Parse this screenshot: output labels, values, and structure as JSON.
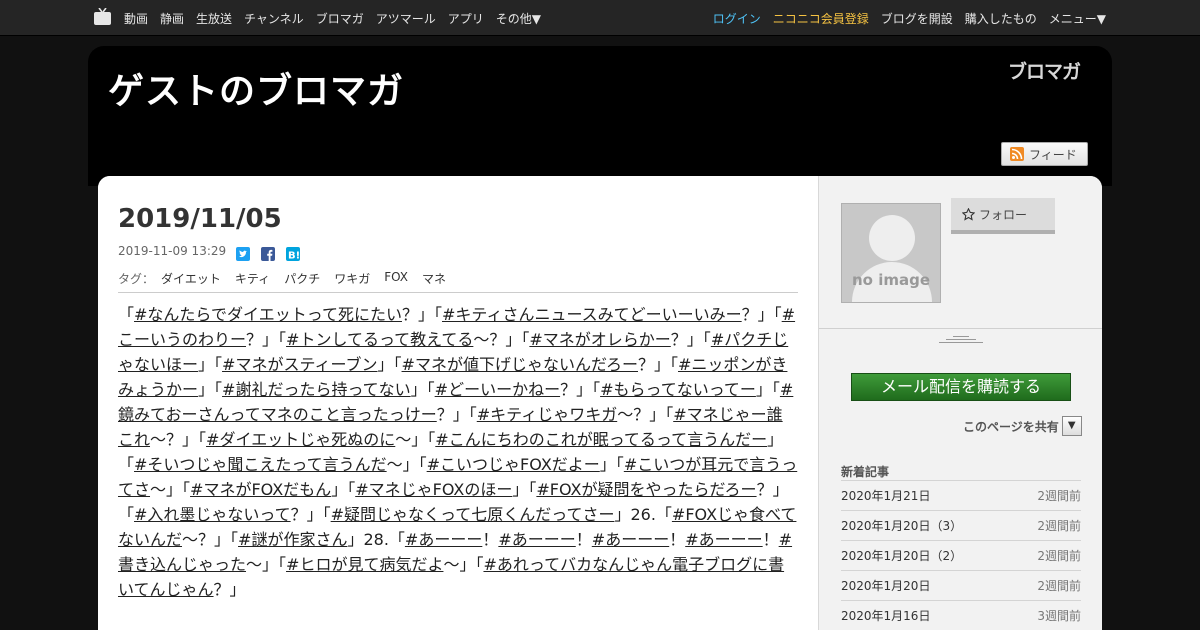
{
  "nav": {
    "left_items": [
      "動画",
      "静画",
      "生放送",
      "チャンネル",
      "ブロマガ",
      "アツマール",
      "アプリ",
      "その他▼"
    ],
    "login": "ログイン",
    "register": "ニコニコ会員登録",
    "open_blog": "ブログを開設",
    "purchased": "購入したもの",
    "menu": "メニュー▼"
  },
  "header": {
    "blog_title": "ゲストのブロマガ",
    "brand_logo": "ブロマガ",
    "feed_label": "フィード"
  },
  "article": {
    "title": "2019/11/05",
    "datetime": "2019-11-09 13:29",
    "tag_label": "タグ：",
    "tags": [
      "ダイエット",
      "キティ",
      "パクチ",
      "ワキガ",
      "FOX",
      "マネ"
    ],
    "body": [
      {
        "t": "「"
      },
      {
        "l": "#なんたらでダイエットって死にたい"
      },
      {
        "t": "？」「"
      },
      {
        "l": "#キティさんニュースみてどーいーいみー"
      },
      {
        "t": "？」「"
      },
      {
        "l": "#こーいうのわりー"
      },
      {
        "t": "？」「"
      },
      {
        "l": "#トンしてるって教えてる"
      },
      {
        "t": "〜？」「"
      },
      {
        "l": "#マネがオレらかー"
      },
      {
        "t": "？」「"
      },
      {
        "l": "#パクチじゃないほー"
      },
      {
        "t": "」「"
      },
      {
        "l": "#マネがスティーブン"
      },
      {
        "t": "」「"
      },
      {
        "l": "#マネが値下げじゃないんだろー"
      },
      {
        "t": "？」「"
      },
      {
        "l": "#ニッポンがきみょうかー"
      },
      {
        "t": "」「"
      },
      {
        "l": "#謝礼だったら持ってない"
      },
      {
        "t": "」「"
      },
      {
        "l": "#どーいーかねー"
      },
      {
        "t": "？」「"
      },
      {
        "l": "#もらってないってー"
      },
      {
        "t": "」「"
      },
      {
        "l": "#鏡みておーさんってマネのこと言ったっけー"
      },
      {
        "t": "？」「"
      },
      {
        "l": "#キティじゃワキガ"
      },
      {
        "t": "〜？」「"
      },
      {
        "l": "#マネじゃー誰これ"
      },
      {
        "t": "〜？」「"
      },
      {
        "l": "#ダイエットじゃ死ぬのに"
      },
      {
        "t": "〜」「"
      },
      {
        "l": "#こんにちわのこれが眠ってるって言うんだー"
      },
      {
        "t": "」「"
      },
      {
        "l": "#そいつじゃ聞こえたって言うんだ"
      },
      {
        "t": "〜」「"
      },
      {
        "l": "#こいつじゃFOXだよー"
      },
      {
        "t": "」「"
      },
      {
        "l": "#こいつが耳元で言うってさ"
      },
      {
        "t": "〜」「"
      },
      {
        "l": "#マネがFOXだもん"
      },
      {
        "t": "」「"
      },
      {
        "l": "#マネじゃFOXのほー"
      },
      {
        "t": "」「"
      },
      {
        "l": "#FOXが疑問をやったらだろー"
      },
      {
        "t": "？」「"
      },
      {
        "l": "#入れ墨じゃないって"
      },
      {
        "t": "？」「"
      },
      {
        "l": "#疑問じゃなくって七原くんだってさー"
      },
      {
        "t": "」26.「"
      },
      {
        "l": "#FOXじゃ食べてないんだ"
      },
      {
        "t": "〜？」「"
      },
      {
        "l": "#謎が作家さん"
      },
      {
        "t": "」28.「"
      },
      {
        "l": "#あーーー"
      },
      {
        "t": "！"
      },
      {
        "l": "#あーーー"
      },
      {
        "t": "！"
      },
      {
        "l": "#あーーー"
      },
      {
        "t": "！"
      },
      {
        "l": "#あーーー"
      },
      {
        "t": "！"
      },
      {
        "l": "#書き込んじゃった"
      },
      {
        "t": "〜」「"
      },
      {
        "l": "#ヒロが見て病気だよ"
      },
      {
        "t": "〜」「"
      },
      {
        "l": "#あれってバカなんじゃん電子ブログに書いてんじゃん"
      },
      {
        "t": "？」"
      }
    ]
  },
  "sidebar": {
    "no_image": "no image",
    "follow": "フォロー",
    "subscribe": "メール配信を購読する",
    "share_page": "このページを共有",
    "share_dropdown": "▼",
    "recent_title": "新着記事",
    "recent": [
      {
        "title": "2020年1月21日",
        "ago": "2週間前"
      },
      {
        "title": "2020年1月20日（3）",
        "ago": "2週間前"
      },
      {
        "title": "2020年1月20日（2）",
        "ago": "2週間前"
      },
      {
        "title": "2020年1月20日",
        "ago": "2週間前"
      },
      {
        "title": "2020年1月16日",
        "ago": "3週間前"
      }
    ]
  },
  "colors": {
    "login": "#4fc3f7",
    "register": "#f5c242",
    "subscribe_green": "#2e8a2a"
  },
  "icons": [
    "niconico-tv-icon",
    "rss-icon",
    "twitter-icon",
    "facebook-icon",
    "hatena-bookmark-icon",
    "star-icon"
  ]
}
